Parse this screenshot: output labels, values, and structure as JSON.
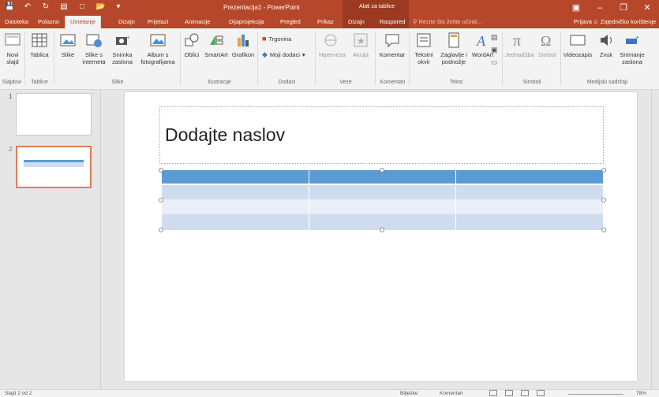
{
  "title_bar": {
    "document_title": "Prezentacija1 - PowerPoint",
    "tools_title": "Alati za tablice",
    "qat": [
      "save-icon",
      "undo-icon",
      "redo-icon",
      "present-icon",
      "new-icon",
      "open-icon",
      "customize-icon"
    ]
  },
  "tabs": [
    {
      "label": "Datoteka"
    },
    {
      "label": "Polazno"
    },
    {
      "label": "Umetanje"
    },
    {
      "label": "Dizajn"
    },
    {
      "label": "Prijelazi"
    },
    {
      "label": "Animacije"
    },
    {
      "label": "Dijaprojekcija"
    },
    {
      "label": "Pregled"
    },
    {
      "label": "Prikaz"
    },
    {
      "label": "Dizajn"
    },
    {
      "label": "Raspored"
    }
  ],
  "tell_me": "Recite što želite učiniti...",
  "sign_in": "Prijava",
  "share": "Zajedničko korištenje",
  "ribbon": {
    "new_slide": "Novi slajd",
    "table": "Tablica",
    "pictures": "Slike",
    "online_pictures": "Slike s interneta",
    "screenshot": "Snimka zaslona",
    "photo_album": "Album s fotografijama",
    "shapes": "Oblici",
    "smartart": "SmartArt",
    "chart": "Grafikon",
    "store": "Trgovina",
    "my_addins": "Moji dodaci",
    "hyperlink": "Hiperveza",
    "action": "Akcija",
    "comment": "Komentar",
    "textbox": "Tekstni okvir",
    "header_footer": "Zaglavlje i podnožje",
    "wordart": "WordArt",
    "equation": "Jednadžba",
    "symbol": "Simbol",
    "video": "Videozapis",
    "audio": "Zvuk",
    "screen_recording": "Snimanje zaslona",
    "groups": {
      "slides": "Slajdovi",
      "tables": "Tablice",
      "images": "Slike",
      "illustrations": "Ilustracije",
      "addins": "Dodaci",
      "links": "Veze",
      "comments": "Komentari",
      "text": "Tekst",
      "symbols": "Simboli",
      "media": "Medijski sadržaji"
    }
  },
  "slides": [
    {
      "number": "1"
    },
    {
      "number": "2"
    }
  ],
  "slide": {
    "title": "Dodajte naslov"
  },
  "status": {
    "slide_info": "Slajd 2 od 2",
    "notes": "Bilješke",
    "comments": "Komentari",
    "zoom": "78%"
  },
  "colors": {
    "accent": "#b7472a",
    "table_header": "#5b9bd5",
    "table_band": "#cfdcef"
  }
}
